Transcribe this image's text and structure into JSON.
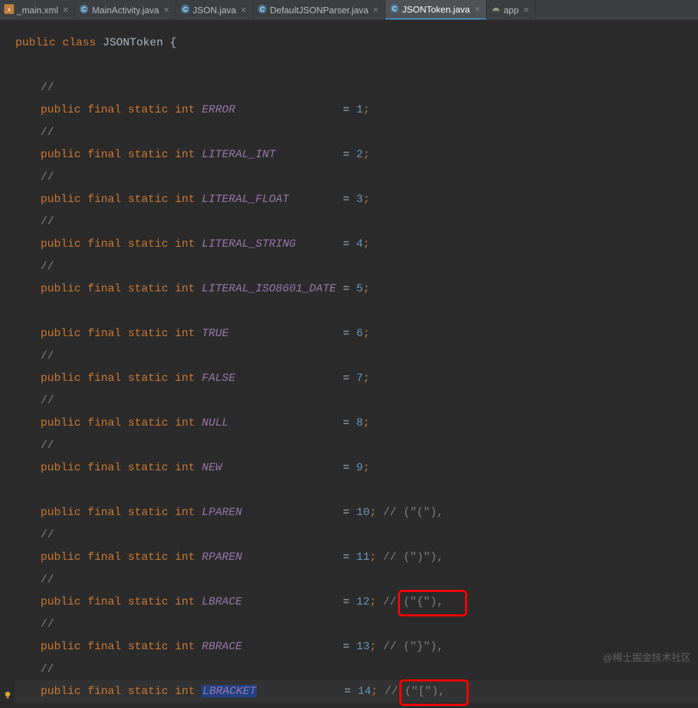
{
  "tabs": [
    {
      "label": "_main.xml",
      "icon": "xml"
    },
    {
      "label": "MainActivity.java",
      "icon": "class"
    },
    {
      "label": "JSON.java",
      "icon": "class"
    },
    {
      "label": "DefaultJSONParser.java",
      "icon": "class"
    },
    {
      "label": "JSONToken.java",
      "icon": "class",
      "active": true
    },
    {
      "label": "app",
      "icon": "gradle"
    }
  ],
  "decl": {
    "kw_public": "public",
    "kw_class": "class",
    "name": "JSONToken",
    "brace": "{"
  },
  "prefix": {
    "public": "public",
    "final": "final",
    "static": "static",
    "int": "int"
  },
  "comment_slash": "//",
  "eq": "=",
  "semi": ";",
  "fields": [
    {
      "name": "ERROR",
      "value": "1",
      "comment": null,
      "leading_comment": true
    },
    {
      "name": "LITERAL_INT",
      "value": "2",
      "comment": null,
      "leading_comment": true
    },
    {
      "name": "LITERAL_FLOAT",
      "value": "3",
      "comment": null,
      "leading_comment": true
    },
    {
      "name": "LITERAL_STRING",
      "value": "4",
      "comment": null,
      "leading_comment": true
    },
    {
      "name": "LITERAL_ISO8601_DATE",
      "value": "5",
      "comment": null,
      "leading_comment": true,
      "blank_after": true
    },
    {
      "name": "TRUE",
      "value": "6",
      "comment": null,
      "leading_comment": false
    },
    {
      "name": "FALSE",
      "value": "7",
      "comment": null,
      "leading_comment": true
    },
    {
      "name": "NULL",
      "value": "8",
      "comment": null,
      "leading_comment": true
    },
    {
      "name": "NEW",
      "value": "9",
      "comment": null,
      "leading_comment": true,
      "blank_after": true
    },
    {
      "name": "LPAREN",
      "value": "10",
      "comment": "(\"(\"),",
      "leading_comment": false
    },
    {
      "name": "RPAREN",
      "value": "11",
      "comment": "(\")\"),",
      "leading_comment": true
    },
    {
      "name": "LBRACE",
      "value": "12",
      "comment": "(\"{\"),",
      "leading_comment": true,
      "boxed": true
    },
    {
      "name": "RBRACE",
      "value": "13",
      "comment": "(\"}\"),",
      "leading_comment": true
    },
    {
      "name": "LBRACKET",
      "value": "14",
      "comment": "(\"[\"),",
      "leading_comment": true,
      "caret": true,
      "selected": true,
      "boxed": true
    }
  ],
  "watermark": "@稀土掘金技术社区"
}
